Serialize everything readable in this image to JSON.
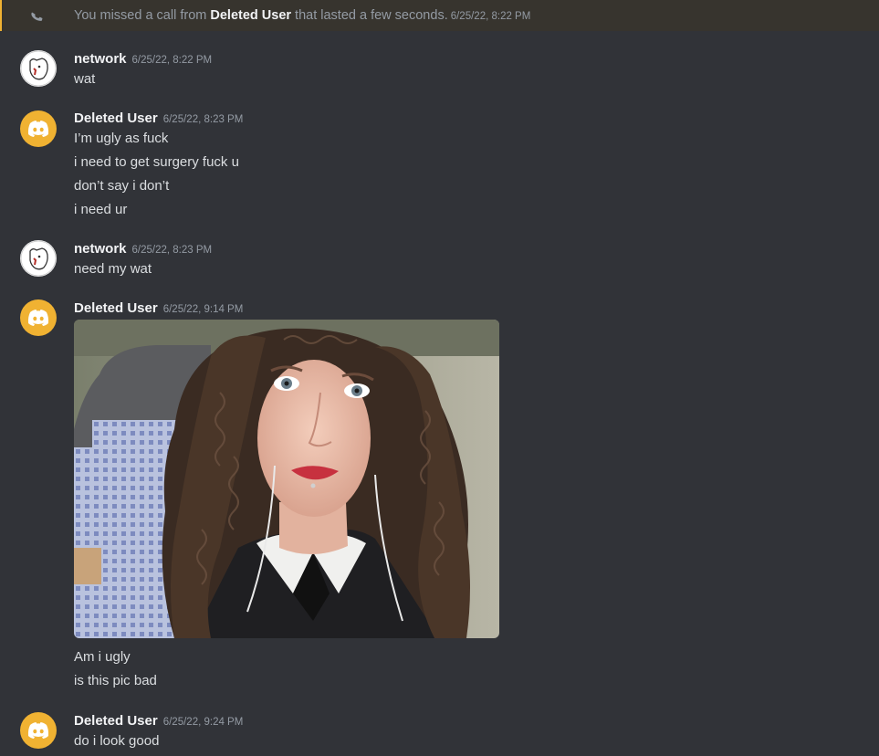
{
  "system": {
    "prefix": "You missed a call from ",
    "caller": "Deleted User",
    "suffix": " that lasted a few seconds.",
    "time": "6/25/22, 8:22 PM"
  },
  "messages": [
    {
      "author": "network",
      "time": "6/25/22, 8:22 PM",
      "lines": [
        "wat"
      ]
    },
    {
      "author": "Deleted User",
      "time": "6/25/22, 8:23 PM",
      "lines": [
        "I’m ugly as fuck",
        "i need to get surgery fuck u",
        "don’t say i don’t",
        "i need ur"
      ]
    },
    {
      "author": "network",
      "time": "6/25/22, 8:23 PM",
      "lines": [
        "need my wat"
      ]
    },
    {
      "author": "Deleted User",
      "time": "6/25/22, 9:14 PM",
      "attachment": "selfie-photo",
      "lines": [
        "Am i ugly",
        "is this pic bad"
      ]
    },
    {
      "author": "Deleted User",
      "time": "6/25/22, 9:24 PM",
      "lines": [
        "do i look good"
      ]
    }
  ],
  "colors": {
    "background": "#313338",
    "discord_avatar": "#f0b232",
    "missed_call_bg": "#37342e",
    "missed_call_bar": "#f0b232"
  }
}
